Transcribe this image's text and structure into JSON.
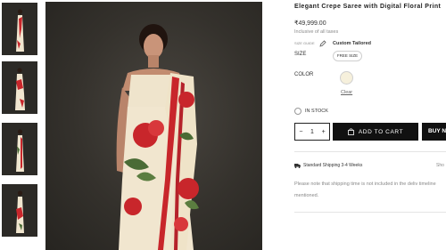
{
  "product": {
    "title": "Elegant Crepe Saree with Digital Floral Print",
    "price": "₹49,999.00",
    "tax_note": "Inclusive of all taxes"
  },
  "size_guide": {
    "label": "SIZE GUIDE",
    "custom_label": "Custom Tailored"
  },
  "size": {
    "label": "SIZE",
    "selected": "FREE SIZE"
  },
  "color": {
    "label": "COLOR",
    "swatch": "#f6f0dc",
    "clear_label": "Clear"
  },
  "stock": {
    "status": "IN STOCK"
  },
  "cart": {
    "quantity": "1",
    "minus": "−",
    "plus": "+",
    "add_label": "ADD TO CART",
    "buy_label": "BUY N"
  },
  "shipping": {
    "title": "Standard Shipping 3-4 Weeks",
    "more": "Sho",
    "note": "Please note that shipping time is not included in the deliv timeline mentioned."
  },
  "colors": {
    "background": "#ffffff",
    "button": "#111111",
    "saree_base": "#f1e6cf",
    "saree_red": "#c8262b",
    "leaf_green": "#4a6b35"
  },
  "gallery": {
    "thumbnail_count": 4
  }
}
